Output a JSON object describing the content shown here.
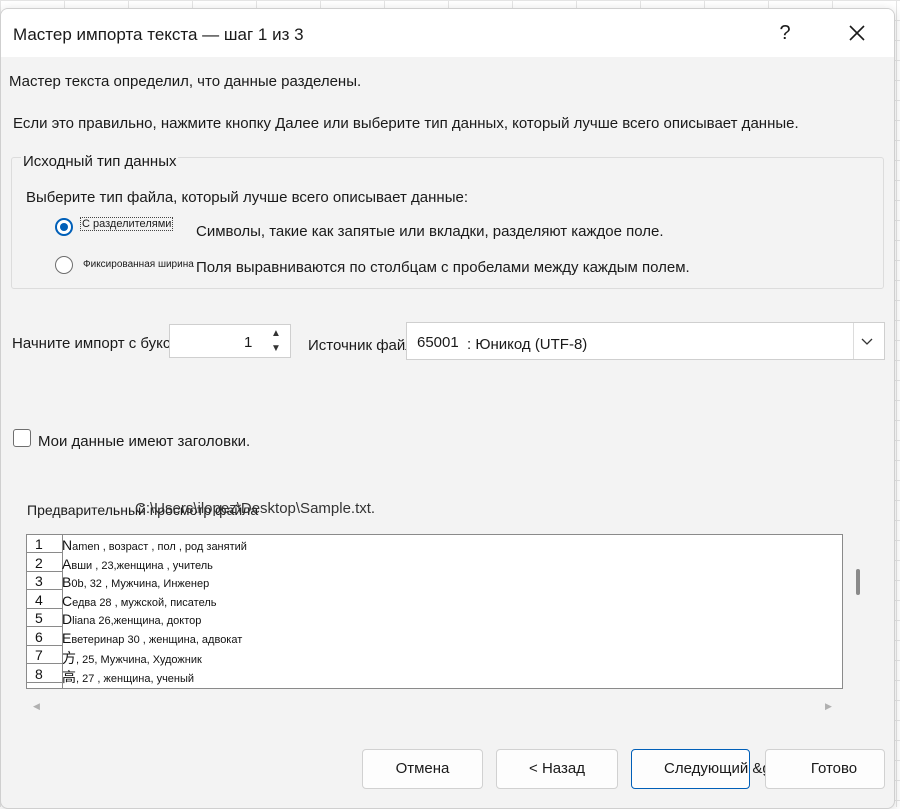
{
  "dialog": {
    "title": "Мастер импорта текста — шаг 1 из 3",
    "help_label": "?",
    "close_icon": "close-icon"
  },
  "intro": {
    "line1": "Мастер текста определил, что данные разделены.",
    "line2": "Если это правильно, нажмите кнопку Далее или выберите тип данных, который лучше всего описывает данные."
  },
  "source_type": {
    "group_label": "Исходный тип данных",
    "prompt": "Выберите тип файла, который лучше всего описывает данные:",
    "options": [
      {
        "label": "С разделителями",
        "description": "Символы, такие как запятые или вкладки, разделяют каждое поле.",
        "selected": true
      },
      {
        "label": "Фиксированная ширина",
        "description": "Поля выравниваются по столбцам с пробелами между каждым полем.",
        "selected": false
      }
    ]
  },
  "start_row": {
    "label": "Начните импорт с буксировки:",
    "value": "1"
  },
  "file_origin": {
    "label": "Источник файла",
    "code": "65001",
    "value": ": Юникод (UTF-8)"
  },
  "headers_checkbox": {
    "label": "Мои данные имеют заголовки.",
    "checked": false
  },
  "preview": {
    "label": "Предварительный просмотр файла",
    "path": "C:\\Users\\ilopez\\Desktop\\Sample.txt.",
    "rows": [
      {
        "num": "1",
        "first": "N",
        "rest": "amen , возраст , пол , род занятий"
      },
      {
        "num": "2",
        "first": "A",
        "rest": "вши , 23,женщина , учитель"
      },
      {
        "num": "3",
        "first": "B",
        "rest": "0b, 32 , Мужчина, Инженер"
      },
      {
        "num": "4",
        "first": "C",
        "rest": "едва 28 , мужской, писатель"
      },
      {
        "num": "5",
        "first": "D",
        "rest": "liana 26,женщина, доктор"
      },
      {
        "num": "6",
        "first": "E",
        "rest": "ветеринар 30 , женщина, адвокат"
      },
      {
        "num": "7",
        "first": "方",
        "rest": ", 25, Мужчина, Художник"
      },
      {
        "num": "8",
        "first": "高",
        "rest": ", 27 , женщина, ученый"
      }
    ]
  },
  "buttons": {
    "cancel": "Отмена",
    "back": "< Назад",
    "next": "Следующий &gt;",
    "finish": "Готово"
  },
  "colors": {
    "accent": "#005fb8",
    "dialog_bg": "#f3f3f3"
  }
}
